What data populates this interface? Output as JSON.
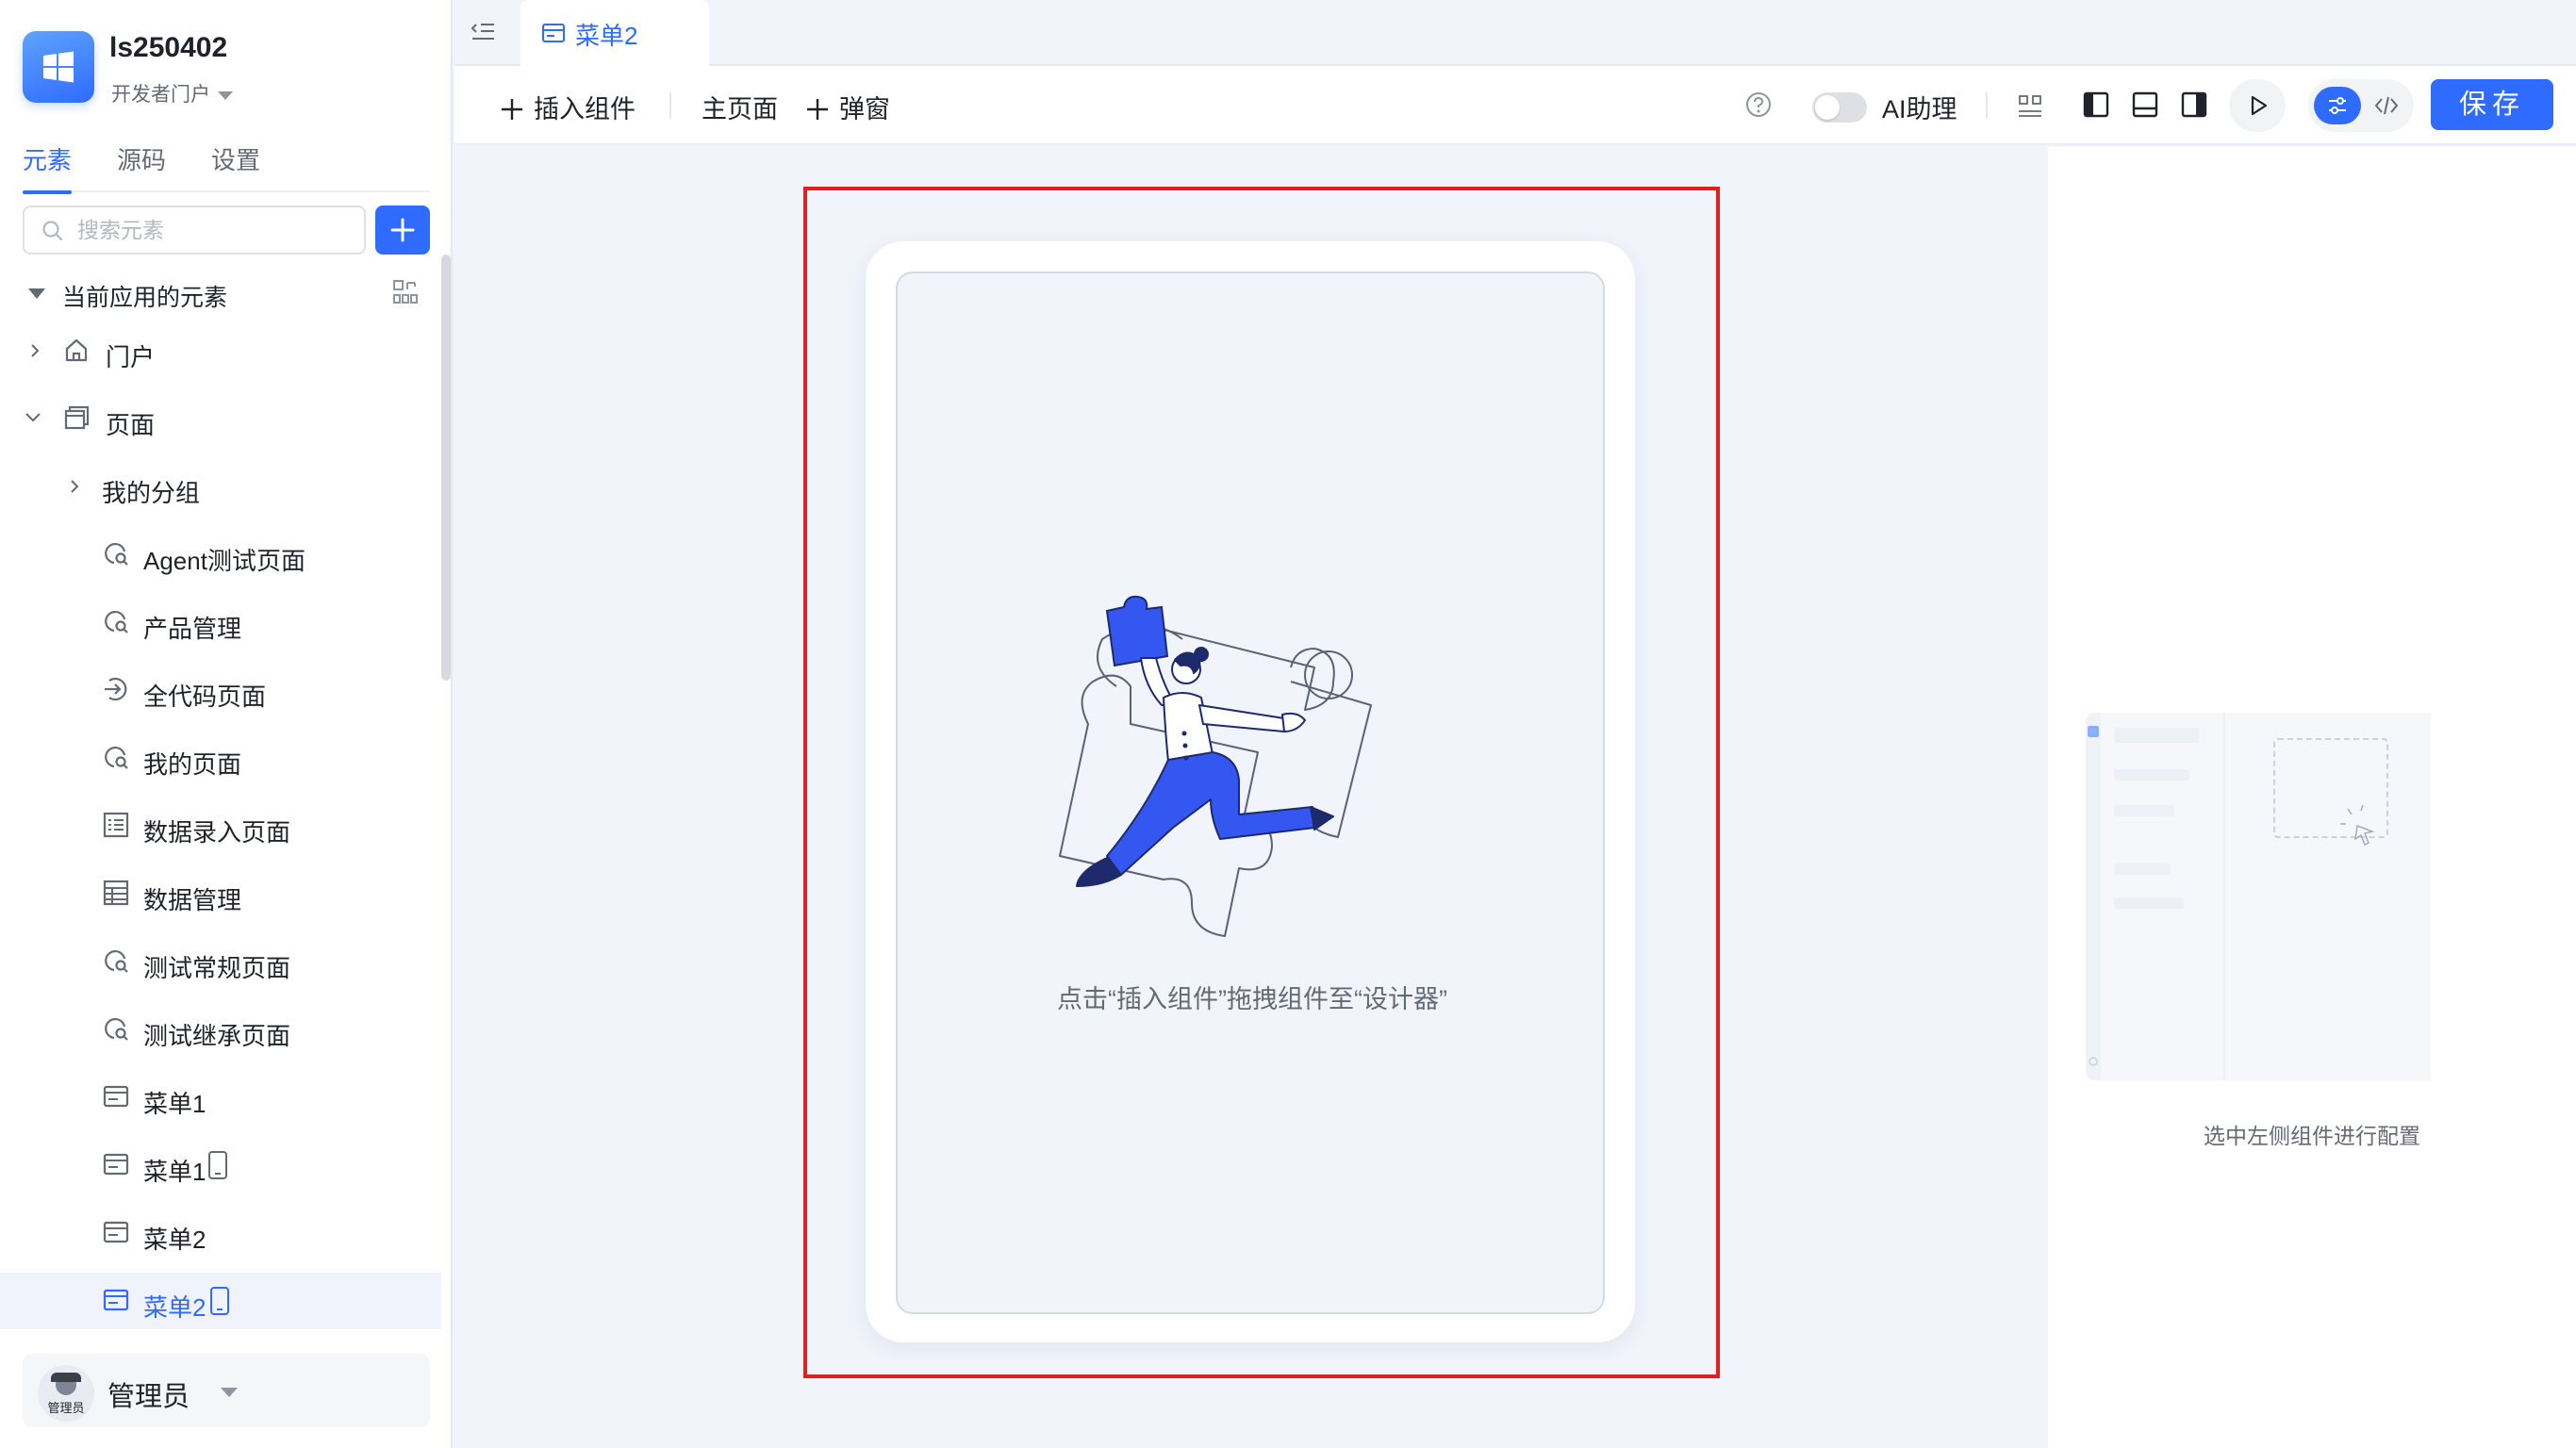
{
  "app": {
    "name": "ls250402",
    "portal": "开发者门户"
  },
  "sidebar": {
    "tabs": [
      {
        "label": "元素",
        "active": true
      },
      {
        "label": "源码",
        "active": false
      },
      {
        "label": "设置",
        "active": false
      }
    ],
    "search_placeholder": "搜索元素",
    "tree_header": "当前应用的元素",
    "tree": [
      {
        "label": "门户",
        "icon": "home-icon",
        "expanded": false
      },
      {
        "label": "页面",
        "icon": "pages-icon",
        "expanded": true
      },
      {
        "label": "我的分组",
        "icon": "",
        "expanded": false
      },
      {
        "label": "Agent测试页面",
        "icon": "page-search-icon"
      },
      {
        "label": "产品管理",
        "icon": "page-search-icon"
      },
      {
        "label": "全代码页面",
        "icon": "code-page-icon"
      },
      {
        "label": "我的页面",
        "icon": "page-search-icon"
      },
      {
        "label": "数据录入页面",
        "icon": "form-page-icon"
      },
      {
        "label": "数据管理",
        "icon": "table-page-icon"
      },
      {
        "label": "测试常规页面",
        "icon": "page-search-icon"
      },
      {
        "label": "测试继承页面",
        "icon": "page-search-icon"
      },
      {
        "label": "菜单1",
        "icon": "menu-page-icon",
        "mobile": false
      },
      {
        "label": "菜单1",
        "icon": "menu-page-icon",
        "mobile": true
      },
      {
        "label": "菜单2",
        "icon": "menu-page-icon",
        "mobile": false
      },
      {
        "label": "菜单2",
        "icon": "menu-page-icon",
        "mobile": true,
        "selected": true
      }
    ],
    "user": {
      "name": "管理员",
      "avatar_tag": "管理员"
    }
  },
  "tabbar": {
    "active_tab": "菜单2"
  },
  "toolbar": {
    "insert_component": "插入组件",
    "main_page": "主页面",
    "popup": "弹窗",
    "ai_assistant": "AI助理",
    "ai_enabled": false,
    "save": "保存"
  },
  "canvas": {
    "empty_hint": "点击“插入组件”拖拽组件至“设计器”"
  },
  "right_panel": {
    "hint": "选中左侧组件进行配置"
  },
  "colors": {
    "accent": "#2f6bff",
    "selection_frame": "#e02020",
    "canvas_bg": "#f1f4fb"
  }
}
